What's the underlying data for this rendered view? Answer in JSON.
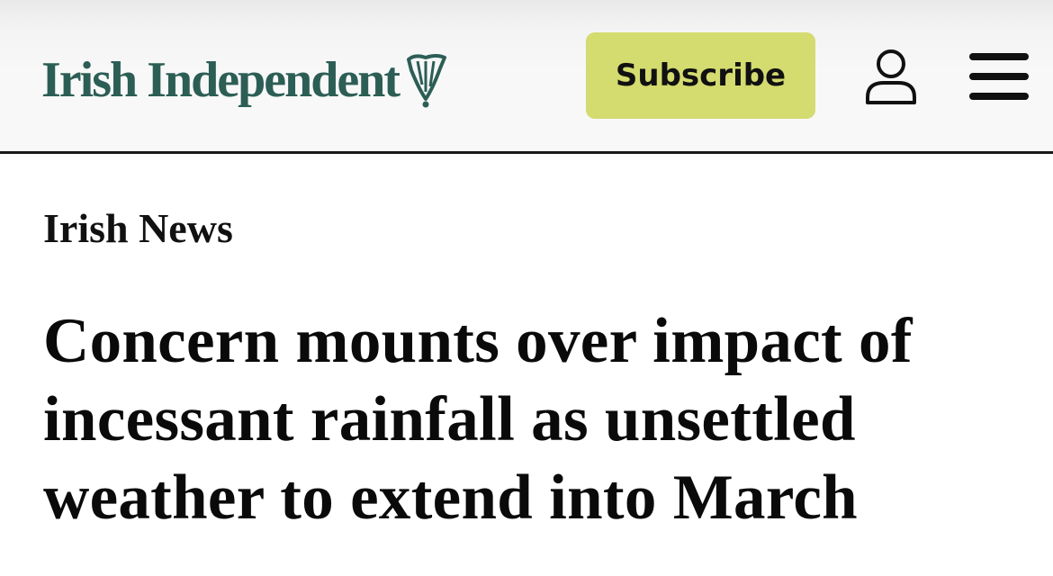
{
  "header": {
    "logo_text": "Irish Independent",
    "logo_icon": "harp-icon",
    "subscribe_label": "Subscribe",
    "account_icon": "user-icon",
    "menu_icon": "menu-icon"
  },
  "article": {
    "section": "Irish News",
    "headline": "Concern mounts over impact of incessant rainfall as unsettled weather to extend into March"
  },
  "colors": {
    "brand": "#2c5e55",
    "subscribe_bg": "#d4db6f",
    "text": "#0a0a0a"
  }
}
